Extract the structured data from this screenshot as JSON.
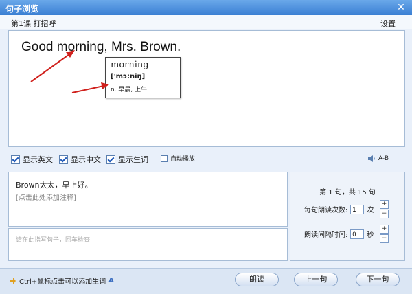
{
  "window": {
    "title": "句子浏览"
  },
  "header": {
    "lesson": "第1课 打招呼",
    "settings": "设置"
  },
  "sentence": {
    "text": "Good morning, Mrs. Brown."
  },
  "popup": {
    "word": "morning",
    "phonetic": "['mɔ:niŋ]",
    "definition": "n. 早晨, 上午"
  },
  "options": {
    "show_english": "显示英文",
    "show_chinese": "显示中文",
    "show_vocab": "显示生词",
    "auto_play": "自动播放",
    "ab": "A-B"
  },
  "translation": {
    "text": "Brown太太，早上好。",
    "note_hint": "[点击此处添加注释]"
  },
  "dictation": {
    "placeholder": "请在此指写句子，回车检查"
  },
  "side": {
    "count": "第 1 句，共 15 句",
    "repeat_label": "每句朗读次数:",
    "repeat_value": "1",
    "repeat_unit": "次",
    "interval_label": "朗读间隔时间:",
    "interval_value": "0",
    "interval_unit": "秒"
  },
  "status": {
    "hint": "Ctrl+鼠标点击可以添加生词",
    "hint_suffix": "A"
  },
  "buttons": {
    "read": "朗读",
    "prev": "上一句",
    "next": "下一句"
  },
  "colors": {
    "titlebar": "#3a7fd3",
    "arrow": "#d0201c"
  }
}
